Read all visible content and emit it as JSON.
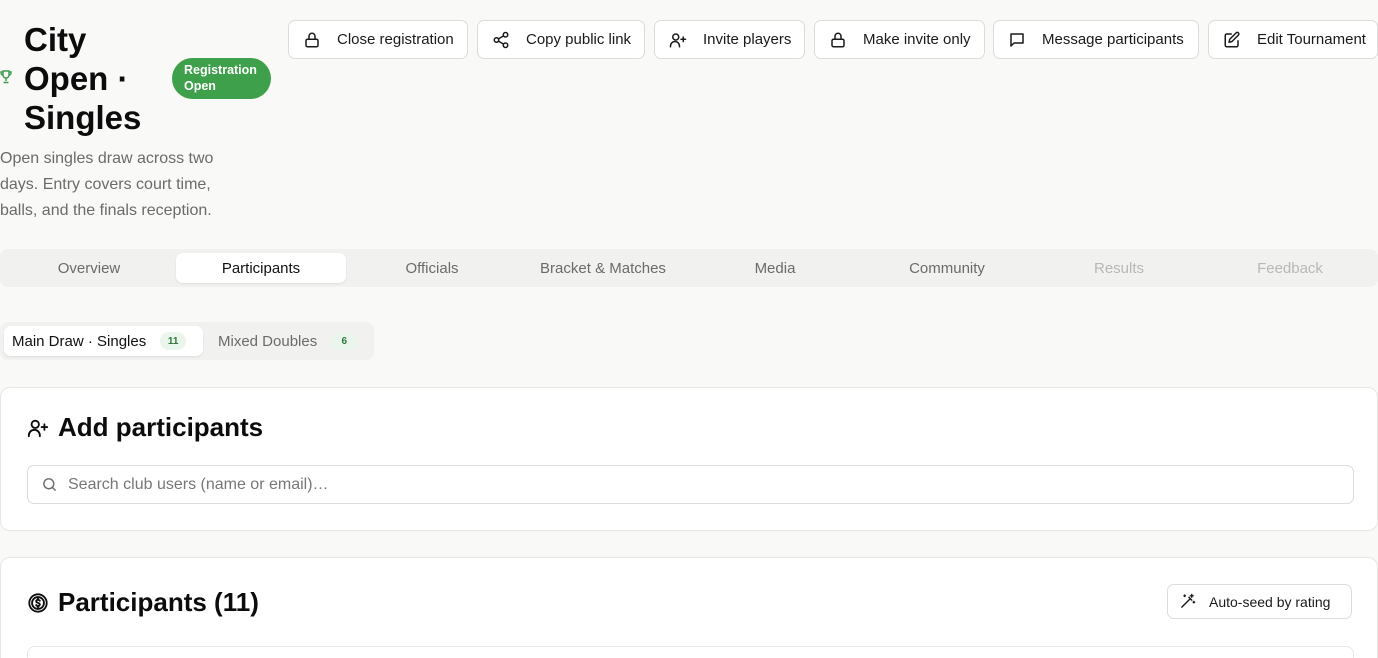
{
  "tournament": {
    "title": "City Open · Singles",
    "status_badge": "Registration Open",
    "description": "Open singles draw across two days. Entry covers court time, balls, and the finals reception.",
    "accent_color": "#3ea04a"
  },
  "actions": [
    {
      "label": "Close registration",
      "icon": "lock-icon"
    },
    {
      "label": "Copy public link",
      "icon": "share-icon"
    },
    {
      "label": "Invite players",
      "icon": "user-plus-icon"
    },
    {
      "label": "Make invite only",
      "icon": "lock-icon"
    },
    {
      "label": "Message participants",
      "icon": "message-icon"
    },
    {
      "label": "Edit Tournament",
      "icon": "edit-icon"
    }
  ],
  "tabs": [
    {
      "label": "Overview",
      "state": "normal"
    },
    {
      "label": "Participants",
      "state": "active"
    },
    {
      "label": "Officials",
      "state": "normal"
    },
    {
      "label": "Bracket & Matches",
      "state": "normal"
    },
    {
      "label": "Media",
      "state": "normal"
    },
    {
      "label": "Community",
      "state": "normal"
    },
    {
      "label": "Results",
      "state": "disabled"
    },
    {
      "label": "Feedback",
      "state": "disabled"
    }
  ],
  "draws": [
    {
      "label": "Main Draw · Singles",
      "count": "11",
      "active": true
    },
    {
      "label": "Mixed Doubles",
      "count": "6",
      "active": false
    }
  ],
  "add_participants": {
    "title": "Add participants",
    "search_placeholder": "Search club users (name or email)…"
  },
  "participants": {
    "title": "Participants (11)",
    "autoseed_label": "Auto-seed by rating"
  }
}
